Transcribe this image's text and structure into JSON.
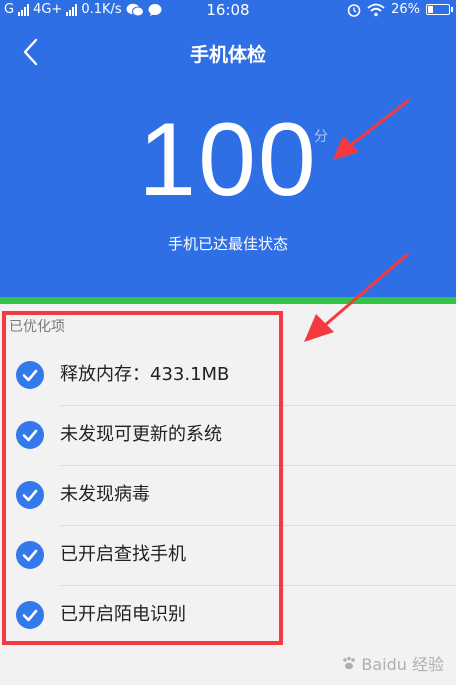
{
  "status_bar": {
    "carrier": "G",
    "network": "4G+",
    "speed": "0.1K/s",
    "time": "16:08",
    "battery": "26%",
    "battery_level": 0.26
  },
  "header": {
    "title": "手机体检"
  },
  "score": {
    "value": "100",
    "unit": "分",
    "status": "手机已达最佳状态"
  },
  "optimized": {
    "label": "已优化项",
    "items": [
      {
        "label": "释放内存：433.1MB"
      },
      {
        "label": "未发现可更新的系统"
      },
      {
        "label": "未发现病毒"
      },
      {
        "label": "已开启查找手机"
      },
      {
        "label": "已开启陌电识别"
      }
    ]
  },
  "colors": {
    "header_blue": "#2f6fe6",
    "green_strip": "#35c24a",
    "check_blue": "#3479ec",
    "annotation_red": "#f53a3f"
  },
  "watermark": {
    "text": "Baidu 经验"
  }
}
